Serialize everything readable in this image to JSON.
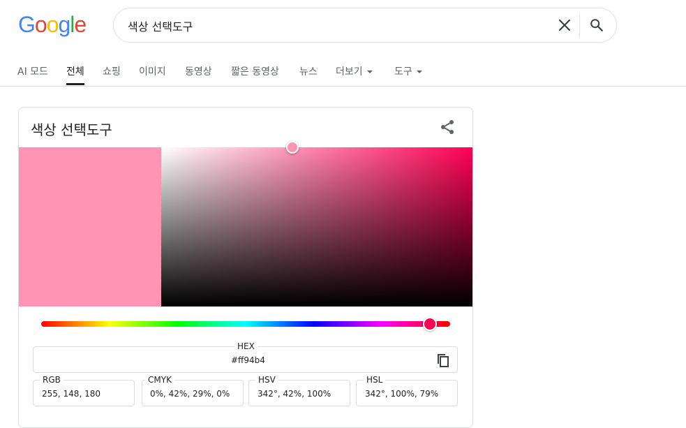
{
  "logo": {
    "letters": [
      "G",
      "o",
      "o",
      "g",
      "l",
      "e"
    ],
    "colors": [
      "#4285f4",
      "#ea4335",
      "#fbbc05",
      "#4285f4",
      "#34a853",
      "#ea4335"
    ]
  },
  "search": {
    "query": "색상 선택도구",
    "clear_icon": "close-icon",
    "search_icon": "search-icon"
  },
  "tabs": [
    {
      "label": "AI 모드",
      "active": false
    },
    {
      "label": "전체",
      "active": true
    },
    {
      "label": "쇼핑",
      "active": false
    },
    {
      "label": "이미지",
      "active": false
    },
    {
      "label": "동영상",
      "active": false
    },
    {
      "label": "짧은 동영상",
      "active": false
    },
    {
      "label": "뉴스",
      "active": false
    },
    {
      "label": "더보기",
      "active": false,
      "dropdown": true
    },
    {
      "label": "도구",
      "active": false,
      "dropdown": true
    }
  ],
  "picker": {
    "title": "색상 선택도구",
    "share_icon": "share-icon",
    "copy_icon": "copy-icon",
    "selected_color": "#ff94b4",
    "hue_color": "#ff0055",
    "hue_degrees": 342,
    "saturation": 0.42,
    "value": 1.0,
    "hex": {
      "label": "HEX",
      "value": "#ff94b4"
    },
    "rgb": {
      "label": "RGB",
      "value": "255, 148, 180"
    },
    "cmyk": {
      "label": "CMYK",
      "value": "0%, 42%, 29%, 0%"
    },
    "hsv": {
      "label": "HSV",
      "value": "342°, 42%, 100%"
    },
    "hsl": {
      "label": "HSL",
      "value": "342°, 100%, 79%"
    }
  }
}
